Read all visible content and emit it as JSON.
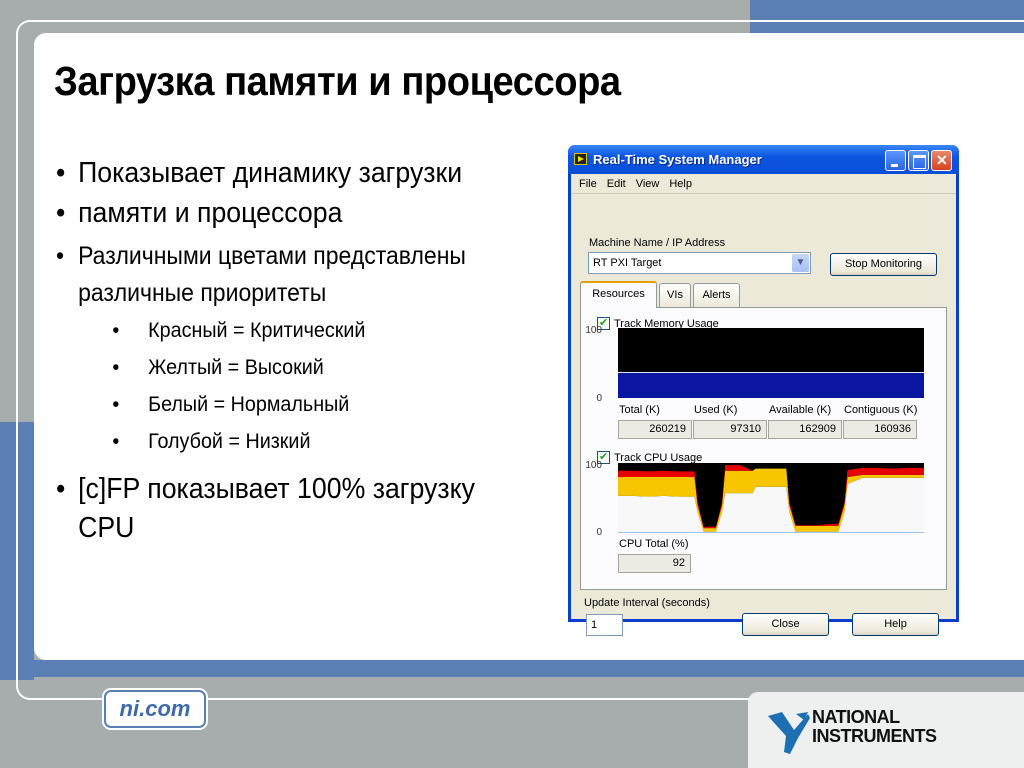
{
  "slide": {
    "title": "Загрузка памяти и процессора",
    "bullets": [
      {
        "text_line1": "Показывает динамику загрузки",
        "text_line2": "памяти и процессора"
      },
      {
        "text_line1": "Различными цветами представлены",
        "text_line2": "различные приоритеты"
      }
    ],
    "sub_bullets": [
      "Красный = Критический",
      "Желтый = Высокий",
      "Белый = Нормальный",
      "Голубой = Низкий"
    ],
    "last_bullet": {
      "text_line1": "[c]FP показывает 100% загрузку",
      "text_line2": "CPU"
    },
    "footer": {
      "site": "ni.com",
      "brand_line1": "NATIONAL",
      "brand_line2": "INSTRUMENTS"
    }
  },
  "window": {
    "title": "Real-Time System Manager",
    "menu": [
      "File",
      "Edit",
      "View",
      "Help"
    ],
    "machine_label": "Machine Name / IP Address",
    "machine_value": "RT PXI Target",
    "stop_button": "Stop Monitoring",
    "tabs": [
      "Resources",
      "VIs",
      "Alerts"
    ],
    "active_tab": "Resources",
    "memory": {
      "checkbox_label": "Track Memory Usage",
      "checked": true,
      "axis_max": "100",
      "axis_min": "0",
      "used_percent": 37,
      "headers": [
        "Total (K)",
        "Used (K)",
        "Available (K)",
        "Contiguous (K)"
      ],
      "values": [
        "260219",
        "97310",
        "162909",
        "160936"
      ]
    },
    "cpu": {
      "checkbox_label": "Track CPU Usage",
      "checked": true,
      "axis_max": "100",
      "axis_min": "0",
      "total_label": "CPU Total (%)",
      "total_value": "92",
      "colors": {
        "critical": "#e60000",
        "high": "#f7c600",
        "normal": "#f8f8f8",
        "idle": "#000000"
      }
    },
    "update_label": "Update Interval (seconds)",
    "update_value": "1",
    "close_button": "Close",
    "help_button": "Help"
  },
  "chart_data": {
    "type": "area",
    "title": "Track CPU Usage",
    "xlabel": "",
    "ylabel": "",
    "ylim": [
      0,
      100
    ],
    "x": [
      0,
      5,
      10,
      15,
      20,
      25,
      26,
      28,
      30,
      32,
      34,
      35,
      40,
      44,
      45,
      50,
      55,
      56,
      58,
      65,
      70,
      72,
      74,
      75,
      80,
      85,
      90,
      95,
      100
    ],
    "series": [
      {
        "name": "Normal (white)",
        "values": [
          53,
          53,
          52,
          53,
          52,
          52,
          30,
          2,
          2,
          2,
          30,
          57,
          57,
          57,
          66,
          66,
          66,
          30,
          2,
          2,
          2,
          2,
          30,
          70,
          79,
          79,
          79,
          79,
          79
        ]
      },
      {
        "name": "High (yellow)",
        "values": [
          27,
          27,
          28,
          27,
          28,
          28,
          10,
          5,
          5,
          5,
          10,
          32,
          32,
          32,
          26,
          26,
          26,
          10,
          8,
          8,
          8,
          8,
          10,
          10,
          4,
          4,
          4,
          4,
          4
        ]
      },
      {
        "name": "Critical (red)",
        "values": [
          9,
          9,
          8,
          9,
          8,
          8,
          4,
          2,
          2,
          2,
          4,
          8,
          8,
          0,
          0,
          0,
          0,
          4,
          1,
          1,
          3,
          3,
          4,
          10,
          10,
          10,
          9,
          10,
          10
        ]
      }
    ]
  }
}
